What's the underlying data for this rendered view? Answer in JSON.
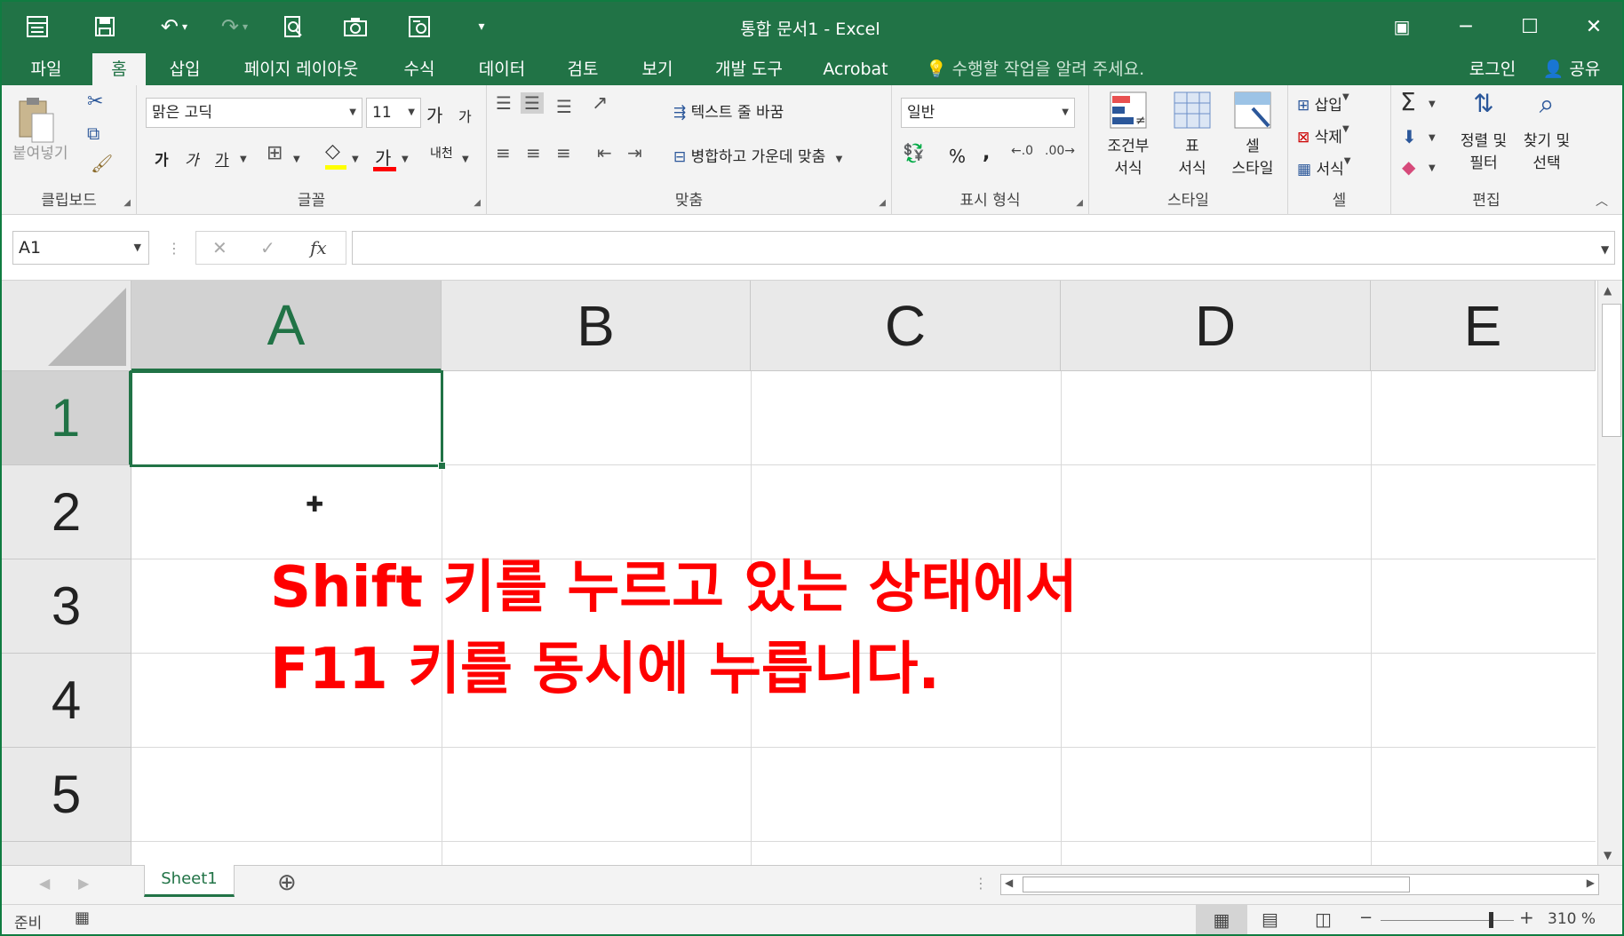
{
  "window": {
    "title": "통합 문서1 - Excel",
    "controls": {
      "ribbon_display": "▣",
      "minimize": "─",
      "maximize": "☐",
      "close": "✕"
    }
  },
  "quick_access": {
    "save": "💾",
    "undo": "↶",
    "redo": "↷",
    "dropdown": "▾"
  },
  "tabs": [
    {
      "label": "파일"
    },
    {
      "label": "홈"
    },
    {
      "label": "삽입"
    },
    {
      "label": "페이지 레이아웃"
    },
    {
      "label": "수식"
    },
    {
      "label": "데이터"
    },
    {
      "label": "검토"
    },
    {
      "label": "보기"
    },
    {
      "label": "개발 도구"
    },
    {
      "label": "Acrobat"
    }
  ],
  "tellme": {
    "placeholder": "수행할 작업을 알려 주세요."
  },
  "account": {
    "login": "로그인",
    "share": "공유"
  },
  "ribbon": {
    "clipboard": {
      "label": "클립보드",
      "paste": "붙여넣기"
    },
    "font": {
      "label": "글꼴",
      "font_name": "맑은 고딕",
      "font_size": "11",
      "grow": "가",
      "shrink": "가",
      "bold": "가",
      "italic": "가",
      "underline": "가",
      "font_color": "가",
      "phonetic": "내천"
    },
    "alignment": {
      "label": "맞춤",
      "wrap_text": "텍스트 줄 바꿈",
      "merge_center": "병합하고 가운데 맞춤"
    },
    "number": {
      "label": "표시 형식",
      "format": "일반",
      "percent": "%",
      "comma": ","
    },
    "styles": {
      "label": "스타일",
      "conditional": [
        "조건부",
        "서식"
      ],
      "table": [
        "표",
        "서식"
      ],
      "cell": [
        "셀",
        "스타일"
      ]
    },
    "cells": {
      "label": "셀",
      "insert": "삽입",
      "delete": "삭제",
      "format": "서식"
    },
    "editing": {
      "label": "편집",
      "sort": [
        "정렬 및",
        "필터"
      ],
      "find": [
        "찾기 및",
        "선택"
      ]
    }
  },
  "formula_bar": {
    "name_box": "A1",
    "fx": "fx",
    "value": ""
  },
  "grid": {
    "columns": [
      "A",
      "B",
      "C",
      "D",
      "E"
    ],
    "rows": [
      "1",
      "2",
      "3",
      "4",
      "5"
    ],
    "selected_cell": "A1"
  },
  "annotation": {
    "line1": "Shift 키를 누르고 있는 상태에서",
    "line2": "F11 키를 동시에 누릅니다.",
    "color": "#ff0000"
  },
  "sheets": {
    "tabs": [
      "Sheet1"
    ],
    "add": "⊕"
  },
  "status": {
    "ready": "준비",
    "zoom": "310 %"
  },
  "colors": {
    "brand": "#217346",
    "selection": "#217346"
  }
}
